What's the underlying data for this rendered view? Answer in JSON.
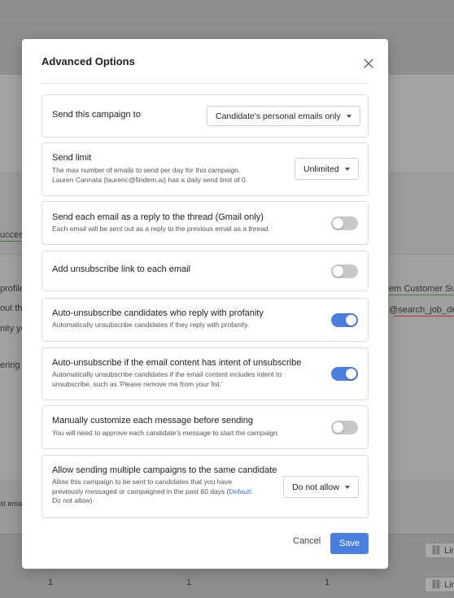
{
  "background": {
    "snippets_left": [
      "ucces",
      "profile",
      "out th",
      "nity yo",
      "ering fi",
      "st ema"
    ],
    "snippets_right": [
      "em Customer Suc",
      "@search_job_de"
    ],
    "footer_link_label": "Lin",
    "footer_numbers": [
      "1",
      "1",
      "1"
    ]
  },
  "modal": {
    "title": "Advanced Options",
    "cancel_label": "Cancel",
    "save_label": "Save",
    "options": {
      "send_to": {
        "title": "Send this campaign to",
        "selected": "Candidate's personal emails only"
      },
      "send_limit": {
        "title": "Send limit",
        "desc_line1": "The max number of emails to send per day for this campaign.",
        "desc_line2": "Lauren Cannata (laurenc@findem.ai) has a daily send limit of 0.",
        "selected": "Unlimited"
      },
      "reply_thread": {
        "title": "Send each email as a reply to the thread (Gmail only)",
        "desc": "Each email will be sent out as a reply to the previous email as a thread.",
        "enabled": false
      },
      "unsubscribe_link": {
        "title": "Add unsubscribe link to each email",
        "enabled": false
      },
      "auto_unsub_profanity": {
        "title": "Auto-unsubscribe candidates who reply with profanity",
        "desc": "Automatically unsubscribe candidates if they reply with profanity.",
        "enabled": true
      },
      "auto_unsub_intent": {
        "title": "Auto-unsubscribe if the email content has intent of unsubscribe",
        "desc_line1": "Automatically unsubscribe candidates if the email content includes intent to",
        "desc_line2": "unsubscribe, such as 'Please remove me from your list.'",
        "enabled": true
      },
      "manual_customize": {
        "title": "Manually customize each message before sending",
        "desc": "You will need to approve each candidate's message to start the campaign.",
        "enabled": false
      },
      "multiple_campaigns": {
        "title": "Allow sending multiple campaigns to the same candidate",
        "desc_line1": "Allow this campaign to be sent to candidates that you have",
        "desc_line2_prefix": "previously messaged or campaigned in the past 60 days (",
        "desc_line2_link": "Default:",
        "desc_line3": "Do not allow)",
        "selected": "Do not allow"
      }
    }
  },
  "colors": {
    "accent": "#4a7fe0",
    "toggle_off": "#c8c8c8",
    "link": "#3b74d9"
  }
}
